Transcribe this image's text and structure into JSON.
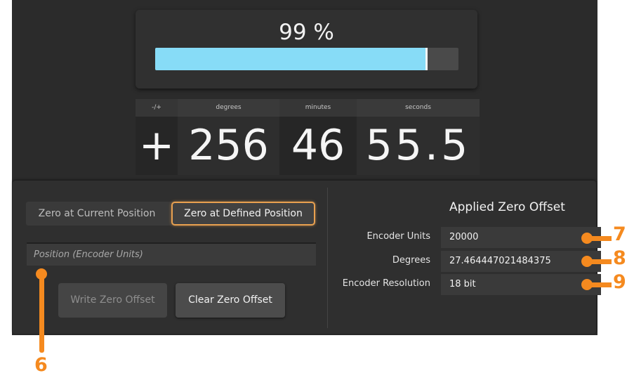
{
  "progress": {
    "text": "99 %",
    "value": 0.99
  },
  "angle": {
    "headers": {
      "sign": "-/+",
      "degrees": "degrees",
      "minutes": "minutes",
      "seconds": "seconds"
    },
    "sign": "+",
    "degrees": "256",
    "minutes": "46",
    "seconds": "55.5"
  },
  "zero_mode": {
    "current": "Zero at Current Position",
    "defined": "Zero at Defined Position",
    "selected": "defined"
  },
  "position_input": {
    "placeholder": "Position (Encoder Units)",
    "value": ""
  },
  "buttons": {
    "write": "Write Zero Offset",
    "clear": "Clear Zero Offset"
  },
  "applied": {
    "title": "Applied Zero Offset",
    "rows": [
      {
        "label": "Encoder Units",
        "value": "20000"
      },
      {
        "label": "Degrees",
        "value": "27.464447021484375"
      },
      {
        "label": "Encoder Resolution",
        "value": "18 bit"
      }
    ]
  },
  "callouts": [
    "6",
    "7",
    "8",
    "9"
  ],
  "colors": {
    "accent": "#e8a050",
    "progress_fill": "#87dcf7",
    "callout": "#f58a1f"
  }
}
